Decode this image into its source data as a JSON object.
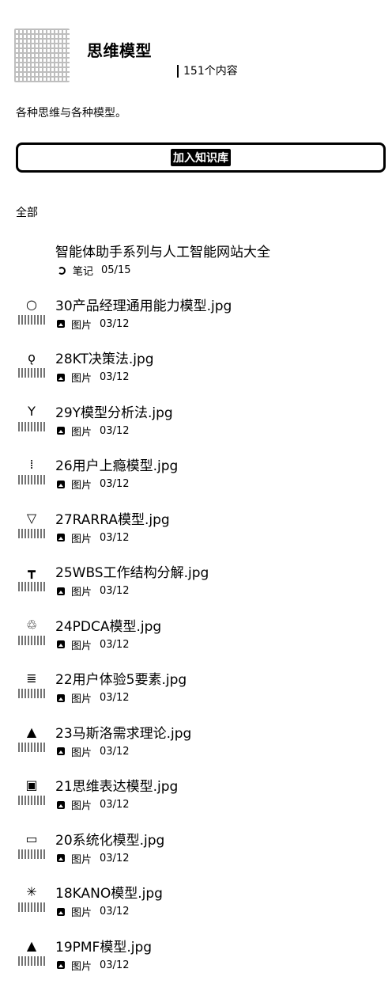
{
  "header": {
    "title": "思维模型",
    "count": "151个内容"
  },
  "description": "各种思维与各种模型。",
  "join_button": "加入知识库",
  "filter": "全部",
  "items": [
    {
      "title": "智能体助手系列与人工智能网站大全",
      "type": "笔记",
      "date": "05/15",
      "icon": "note-icon",
      "thumb": ""
    },
    {
      "title": "30产品经理通用能力模型.jpg",
      "type": "图片",
      "date": "03/12",
      "icon": "image-icon",
      "thumb": "○"
    },
    {
      "title": "28KT决策法.jpg",
      "type": "图片",
      "date": "03/12",
      "icon": "image-icon",
      "thumb": "ǫ"
    },
    {
      "title": "29Y模型分析法.jpg",
      "type": "图片",
      "date": "03/12",
      "icon": "image-icon",
      "thumb": "Y"
    },
    {
      "title": "26用户上瘾模型.jpg",
      "type": "图片",
      "date": "03/12",
      "icon": "image-icon",
      "thumb": "⁞"
    },
    {
      "title": "27RARRA模型.jpg",
      "type": "图片",
      "date": "03/12",
      "icon": "image-icon",
      "thumb": "▽"
    },
    {
      "title": "25WBS工作结构分解.jpg",
      "type": "图片",
      "date": "03/12",
      "icon": "image-icon",
      "thumb": "┳"
    },
    {
      "title": "24PDCA模型.jpg",
      "type": "图片",
      "date": "03/12",
      "icon": "image-icon",
      "thumb": "♲"
    },
    {
      "title": "22用户体验5要素.jpg",
      "type": "图片",
      "date": "03/12",
      "icon": "image-icon",
      "thumb": "≣"
    },
    {
      "title": "23马斯洛需求理论.jpg",
      "type": "图片",
      "date": "03/12",
      "icon": "image-icon",
      "thumb": "▲"
    },
    {
      "title": "21思维表达模型.jpg",
      "type": "图片",
      "date": "03/12",
      "icon": "image-icon",
      "thumb": "▣"
    },
    {
      "title": "20系统化模型.jpg",
      "type": "图片",
      "date": "03/12",
      "icon": "image-icon",
      "thumb": "▭"
    },
    {
      "title": "18KANO模型.jpg",
      "type": "图片",
      "date": "03/12",
      "icon": "image-icon",
      "thumb": "✳"
    },
    {
      "title": "19PMF模型.jpg",
      "type": "图片",
      "date": "03/12",
      "icon": "image-icon",
      "thumb": "▲"
    }
  ]
}
